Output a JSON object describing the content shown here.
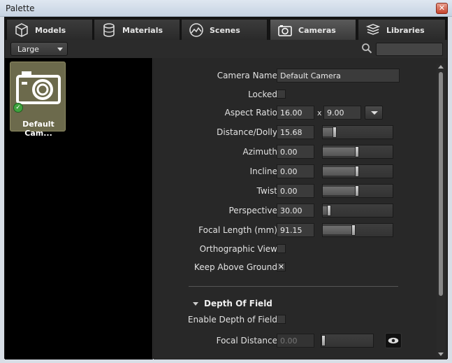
{
  "window": {
    "title": "Palette",
    "close_label": "✕"
  },
  "tabs": [
    {
      "label": "Models",
      "icon": "cube-icon"
    },
    {
      "label": "Materials",
      "icon": "cylinder-icon"
    },
    {
      "label": "Scenes",
      "icon": "scene-icon"
    },
    {
      "label": "Cameras",
      "icon": "camera-icon",
      "active": true
    },
    {
      "label": "Libraries",
      "icon": "books-icon"
    }
  ],
  "toolbar": {
    "size_select": "Large",
    "search": {
      "value": ""
    }
  },
  "library": {
    "items": [
      {
        "label": "Default Cam...",
        "checked": true
      }
    ]
  },
  "properties": {
    "camera_name": {
      "label": "Camera Name",
      "value": "Default Camera"
    },
    "locked": {
      "label": "Locked",
      "checked": false
    },
    "aspect_ratio": {
      "label": "Aspect Ratio",
      "width": "16.00",
      "separator": "x",
      "height": "9.00"
    },
    "distance": {
      "label": "Distance/Dolly",
      "value": "15.68",
      "slider": 0.15
    },
    "azimuth": {
      "label": "Azimuth",
      "value": "0.00",
      "slider": 0.5
    },
    "incline": {
      "label": "Incline",
      "value": "0.00",
      "slider": 0.5
    },
    "twist": {
      "label": "Twist",
      "value": "0.00",
      "slider": 0.5
    },
    "perspective": {
      "label": "Perspective",
      "value": "30.00",
      "slider": 0.07
    },
    "focal_length": {
      "label": "Focal Length (mm)",
      "value": "91.15",
      "slider": 0.45
    },
    "ortho": {
      "label": "Orthographic View",
      "checked": false
    },
    "keep_above": {
      "label": "Keep Above Ground",
      "checked": true,
      "mark": "✕"
    },
    "dof_section": {
      "label": "Depth Of Field"
    },
    "enable_dof": {
      "label": "Enable Depth of Field",
      "checked": false
    },
    "focal_distance": {
      "label": "Focal Distance",
      "value": "0.00",
      "slider": 0.0
    }
  },
  "colors": {
    "panel": "#282828",
    "tab_active": "#4a4a4a",
    "thumb": "#6c6a4c"
  }
}
